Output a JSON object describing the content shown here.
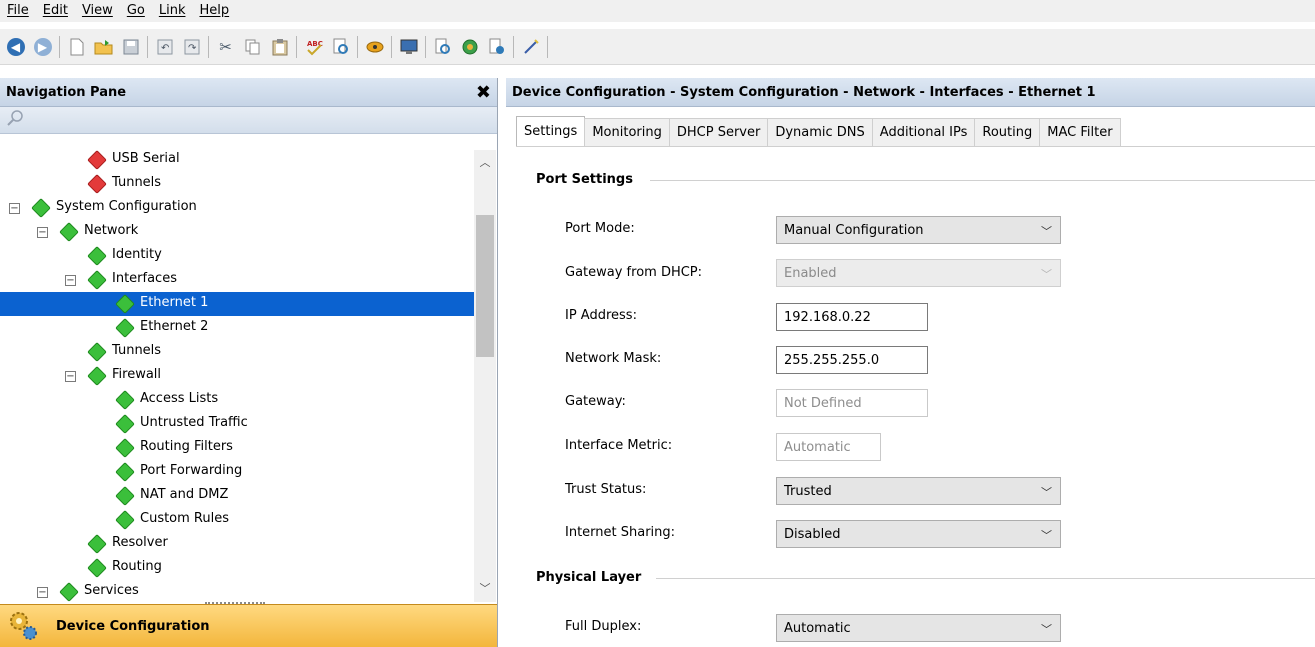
{
  "menu": [
    "File",
    "Edit",
    "View",
    "Go",
    "Link",
    "Help"
  ],
  "nav": {
    "title": "Navigation Pane",
    "close_glyph": "✖",
    "tree": [
      {
        "label": "USB Serial",
        "status": "red"
      },
      {
        "label": "Tunnels",
        "status": "red"
      },
      {
        "label": "System Configuration",
        "status": "green",
        "expander": "⊟"
      },
      {
        "label": "Network",
        "status": "green",
        "expander": "⊟"
      },
      {
        "label": "Identity",
        "status": "green"
      },
      {
        "label": "Interfaces",
        "status": "green",
        "expander": "⊟"
      },
      {
        "label": "Ethernet 1",
        "status": "green",
        "selected": true
      },
      {
        "label": "Ethernet 2",
        "status": "green"
      },
      {
        "label": "Tunnels",
        "status": "green"
      },
      {
        "label": "Firewall",
        "status": "green",
        "expander": "⊟"
      },
      {
        "label": "Access Lists",
        "status": "green"
      },
      {
        "label": "Untrusted Traffic",
        "status": "green"
      },
      {
        "label": "Routing Filters",
        "status": "green"
      },
      {
        "label": "Port Forwarding",
        "status": "green"
      },
      {
        "label": "NAT and DMZ",
        "status": "green"
      },
      {
        "label": "Custom Rules",
        "status": "green"
      },
      {
        "label": "Resolver",
        "status": "green"
      },
      {
        "label": "Routing",
        "status": "green"
      },
      {
        "label": "Services",
        "status": "green",
        "expander": "⊟"
      }
    ],
    "footer_label": "Device Configuration"
  },
  "content": {
    "breadcrumb": "Device Configuration - System Configuration - Network - Interfaces - Ethernet 1",
    "tabs": [
      "Settings",
      "Monitoring",
      "DHCP Server",
      "Dynamic DNS",
      "Additional IPs",
      "Routing",
      "MAC Filter"
    ],
    "active_tab": "Settings",
    "port_settings": {
      "title": "Port Settings",
      "port_mode_label": "Port Mode:",
      "port_mode_value": "Manual Configuration",
      "gateway_dhcp_label": "Gateway from DHCP:",
      "gateway_dhcp_value": "Enabled",
      "ip_label": "IP Address:",
      "ip_value": "192.168.0.22",
      "mask_label": "Network Mask:",
      "mask_value": "255.255.255.0",
      "gateway_label": "Gateway:",
      "gateway_value": "Not Defined",
      "metric_label": "Interface Metric:",
      "metric_value": "Automatic",
      "trust_label": "Trust Status:",
      "trust_value": "Trusted",
      "sharing_label": "Internet Sharing:",
      "sharing_value": "Disabled"
    },
    "physical_layer": {
      "title": "Physical Layer",
      "duplex_label": "Full Duplex:",
      "duplex_value": "Automatic"
    }
  },
  "colors": {
    "selection": "#0b62d0",
    "status_green": "#3bbf3b",
    "status_red": "#e33a3a",
    "footer_gold": "#f3b63c"
  }
}
